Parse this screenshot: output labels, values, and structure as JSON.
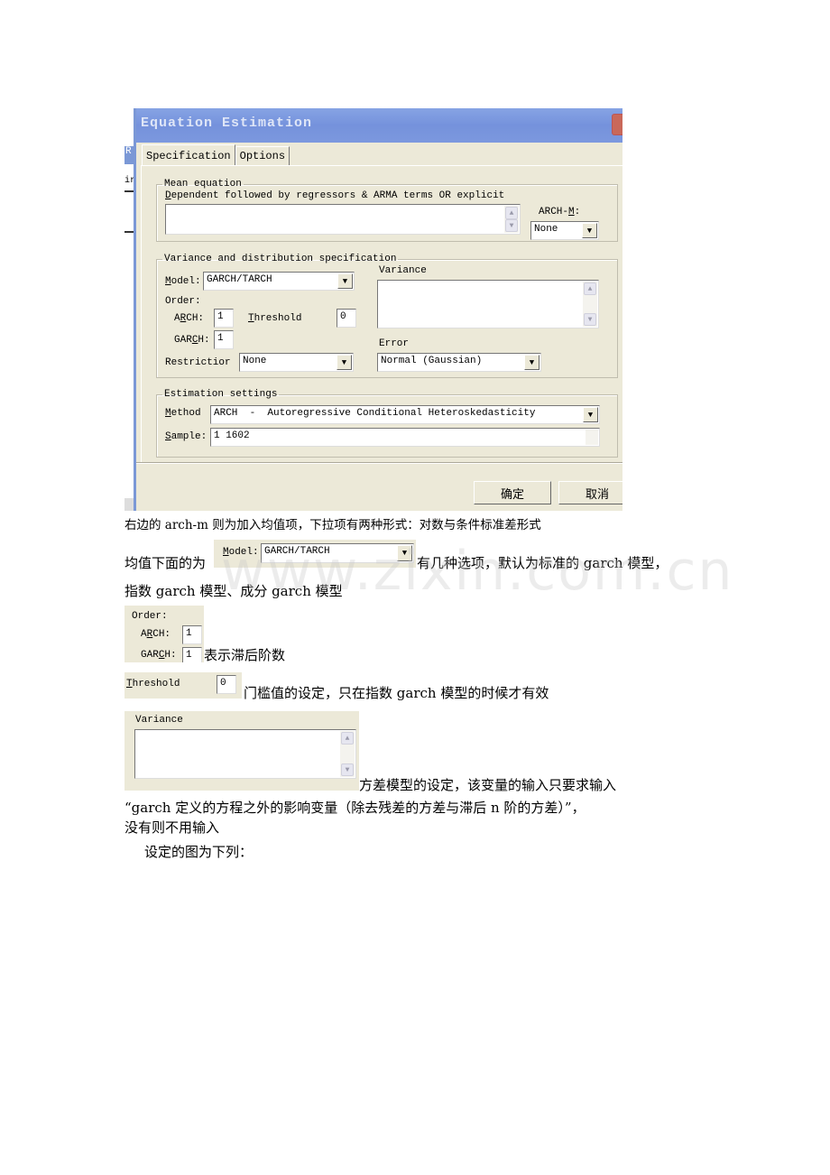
{
  "dialog": {
    "title": "Equation Estimation",
    "tabs": [
      {
        "label": "Specification",
        "active": true
      },
      {
        "label": "Options",
        "active": false
      }
    ],
    "background_window_fragments": [
      "R",
      "ir"
    ],
    "mean_equation": {
      "group_label": "Mean equation",
      "field_label_accel": "D",
      "field_label_rest": "ependent followed by regressors & ARMA terms OR explicit",
      "value": "",
      "archm_label_pre": "ARCH-",
      "archm_label_accel": "M",
      "archm_label_post": ":",
      "archm_value": "None"
    },
    "variance_spec": {
      "group_label": "Variance and distribution specification",
      "model_label_accel": "M",
      "model_label_rest": "odel:",
      "model_value": "GARCH/TARCH",
      "order_label": "Order:",
      "arch_label_pre": "A",
      "arch_label_accel": "R",
      "arch_label_post": "CH:",
      "arch_value": "1",
      "threshold_label_accel": "T",
      "threshold_label_rest": "hreshold",
      "threshold_value": "0",
      "garch_label_pre": "GAR",
      "garch_label_accel": "C",
      "garch_label_post": "H:",
      "garch_value": "1",
      "restriction_label": "Restrictior",
      "restriction_value": "None",
      "variance_label": "Variance",
      "variance_value": "",
      "error_label": "Error",
      "error_value": "Normal (Gaussian)"
    },
    "estimation": {
      "group_label": "Estimation settings",
      "method_label_accel": "M",
      "method_label_rest": "ethod",
      "method_value": "ARCH  -  Autoregressive Conditional Heteroskedasticity",
      "sample_label_accel": "S",
      "sample_label_rest": "ample:",
      "sample_value": "1 1602"
    },
    "buttons": {
      "ok": "确定",
      "cancel": "取消"
    }
  },
  "document": {
    "p1": "右边的 arch-m 则为加入均值项，下拉项有两种形式：对数与条件标准差形式",
    "p2_before": "均值下面的为",
    "p2_after": "有几种选项，默认为标准的 garch 模型，",
    "p2_line2": "指数 garch 模型、成分 garch 模型",
    "p3_after": "表示滞后阶数",
    "p4_after": "门槛值的设定，只在指数 garch 模型的时候才有效",
    "p5_after": "方差模型的设定，该变量的输入只要求输入",
    "p5_line2": "“garch 定义的方程之外的影响变量（除去残差的方差与滞后 n 阶的方差）”，",
    "p5_line3": "没有则不用输入",
    "p6": "设定的图为下列："
  },
  "watermark": "www.zixin.com.cn"
}
